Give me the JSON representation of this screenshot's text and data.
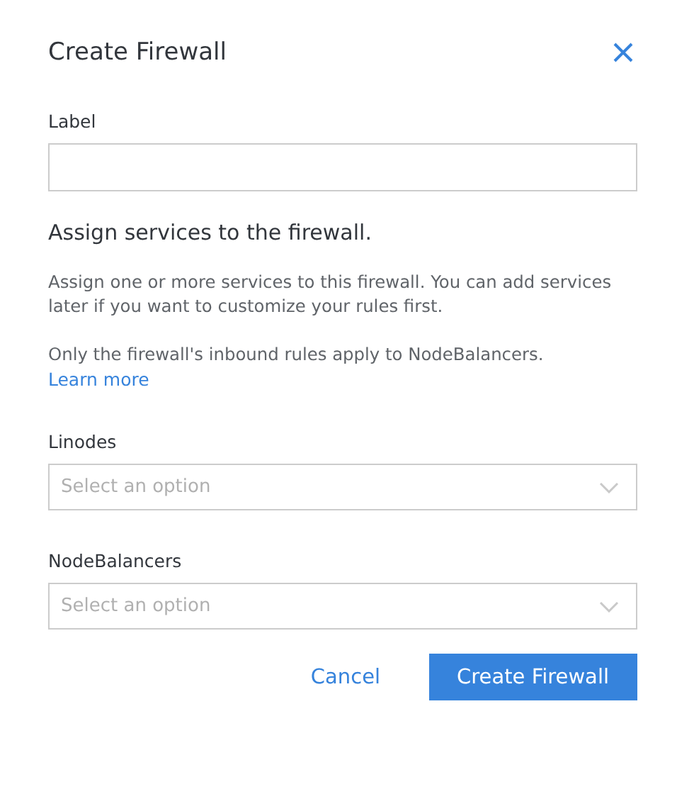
{
  "dialog": {
    "title": "Create Firewall"
  },
  "label_field": {
    "label": "Label"
  },
  "section": {
    "heading": "Assign services to the firewall.",
    "paragraphs": [
      "Assign one or more services to this firewall. You can add services later if you want to customize your rules first.",
      "Only the firewall's inbound rules apply to NodeBalancers."
    ],
    "link": "Learn more"
  },
  "selects": [
    {
      "label": "Linodes",
      "placeholder": "Select an option"
    },
    {
      "label": "NodeBalancers",
      "placeholder": "Select an option"
    }
  ],
  "buttons": [
    {
      "label": "Cancel",
      "kind": "secondary"
    },
    {
      "label": "Create Firewall",
      "kind": "primary"
    }
  ]
}
